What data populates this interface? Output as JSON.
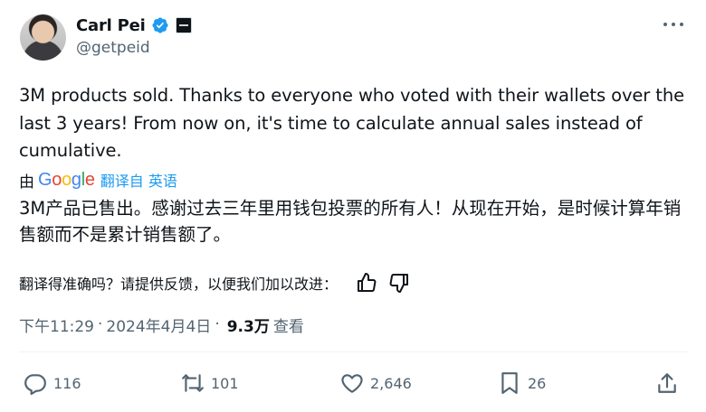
{
  "author": {
    "display_name": "Carl Pei",
    "handle": "@getpeid"
  },
  "tweet": {
    "text": "3M products sold. Thanks to everyone who voted with their wallets over the last 3 years! From now on, it's time to calculate annual sales instead of cumulative."
  },
  "translation": {
    "by_label": "由",
    "provider": "Google",
    "from_language": "翻译自 英语",
    "text": "3M产品已售出。感谢过去三年里用钱包投票的所有人！从现在开始，是时候计算年销售额而不是累计销售额了。",
    "feedback_question": "翻译得准确吗？请提供反馈，以便我们加以改进："
  },
  "meta": {
    "time": "下午11:29",
    "sep": "·",
    "date": "2024年4月4日",
    "views_count": "9.3万",
    "views_label": "查看"
  },
  "actions": {
    "replies": "116",
    "reposts": "101",
    "likes": "2,646",
    "bookmarks": "26"
  },
  "colors": {
    "accent": "#1d9bf0",
    "secondary_text": "#536471",
    "primary_text": "#0f1419"
  },
  "icons": [
    "verified-badge-icon",
    "affiliate-badge-icon",
    "more-icon",
    "thumbs-up-icon",
    "thumbs-down-icon",
    "reply-icon",
    "repost-icon",
    "like-icon",
    "bookmark-icon",
    "share-icon"
  ]
}
